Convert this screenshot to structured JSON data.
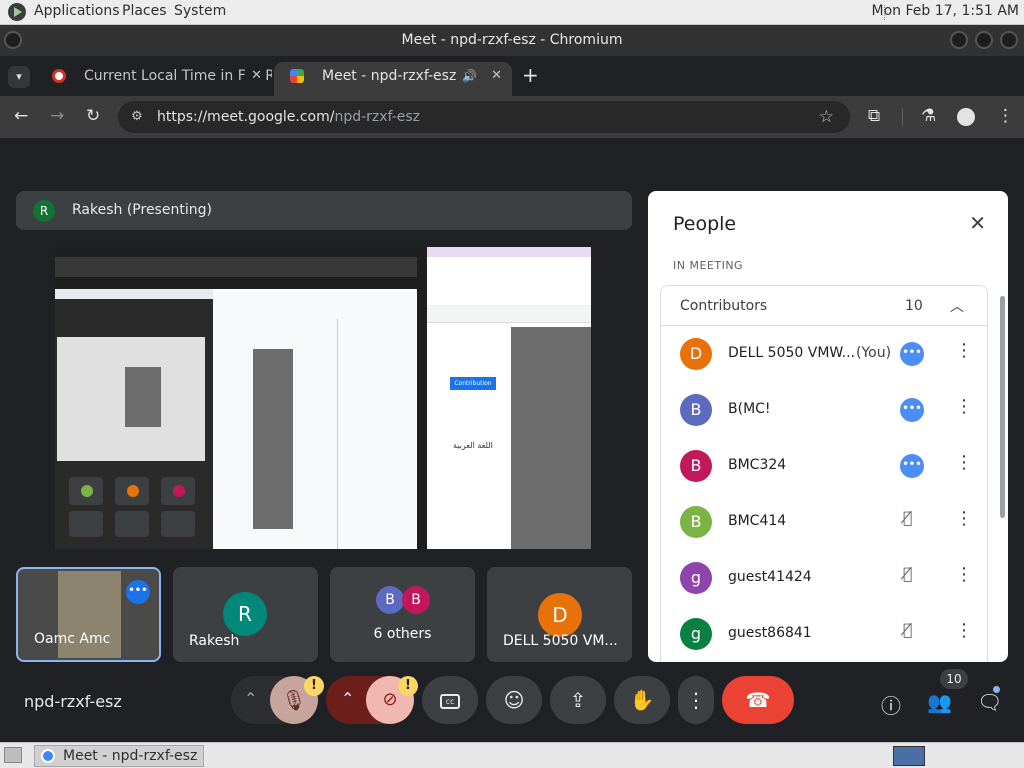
{
  "topbar": {
    "menus": [
      "Applications",
      "Places",
      "System"
    ],
    "clock": "Mon Feb 17,  1:51 AM"
  },
  "window": {
    "title": "Meet - npd-rzxf-esz - Chromium"
  },
  "tabs": [
    {
      "label": "Current Local Time in Fall Riv",
      "active": false
    },
    {
      "label": "Meet - npd-rzxf-esz",
      "active": true
    }
  ],
  "toolbar": {
    "url_host": "https://meet.google.com/",
    "url_path": "npd-rzxf-esz"
  },
  "meet": {
    "presenting": {
      "initial": "R",
      "label": "Rakesh (Presenting)"
    },
    "shared_screen_text": [
      "Contribution",
      "اللغة العربية"
    ],
    "tiles": [
      {
        "name": "Oamc Amc"
      },
      {
        "initial": "R",
        "name": "Rakesh"
      },
      {
        "initials": [
          "B",
          "B"
        ],
        "name": "6 others"
      },
      {
        "initial": "D",
        "name": "DELL 5050 VM..."
      }
    ],
    "meeting_id": "npd-rzxf-esz",
    "badges": {
      "mic_warning": "!",
      "cam_warning": "!",
      "people_count": "10"
    }
  },
  "people": {
    "title": "People",
    "section": "IN MEETING",
    "group": {
      "label": "Contributors",
      "count": "10"
    },
    "rows": [
      {
        "initial": "D",
        "name": "DELL 5050 VMW...",
        "you": "(You)",
        "color": "#e8710a",
        "speaking": true
      },
      {
        "initial": "B",
        "name": "B(MC!",
        "you": "",
        "color": "#5c6bc0",
        "speaking": true
      },
      {
        "initial": "B",
        "name": "BMC324",
        "you": "",
        "color": "#c2185b",
        "speaking": true
      },
      {
        "initial": "B",
        "name": "BMC414",
        "you": "",
        "color": "#7cb342",
        "speaking": false
      },
      {
        "initial": "g",
        "name": "guest41424",
        "you": "",
        "color": "#8e44ad",
        "speaking": false
      },
      {
        "initial": "g",
        "name": "guest86841",
        "you": "",
        "color": "#0b8043",
        "speaking": false
      }
    ]
  },
  "taskbar": {
    "item": "Meet - npd-rzxf-esz ..."
  },
  "colors": {
    "accent": "#1a73e8",
    "hangup": "#ea4335",
    "panel_bg": "#ffffff",
    "dark_bg": "#202124"
  }
}
